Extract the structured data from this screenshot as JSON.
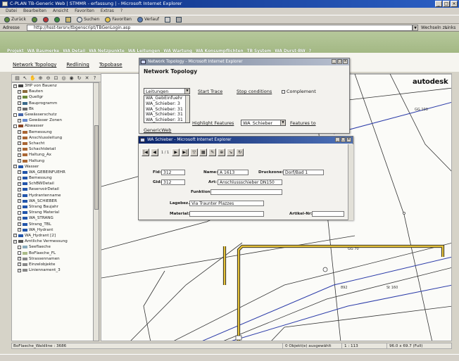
{
  "window": {
    "title": "C-PLAN TB-Generic Web | STMMR - erfassung | - Microsoft Internet Explorer"
  },
  "menu": [
    "Datei",
    "Bearbeiten",
    "Ansicht",
    "Favoriten",
    "Extras",
    "?"
  ],
  "toolbar": {
    "back": "Zurück",
    "search": "Suchen",
    "favorites": "Favoriten",
    "history": "Verlauf"
  },
  "address": {
    "label": "Adresse",
    "url": "http://hsst-tersrv/tbgenscript/TBGenLogin.asp",
    "go": "Wechseln zu",
    "links": "Links"
  },
  "app_nav": [
    "Projekt",
    "WA Baumerke",
    "WA Detail",
    "WA Netzpunkte",
    "WA Leitungen",
    "WA Wartung",
    "WA Konsumpflichten",
    "TB System",
    "WA Durst-BW",
    "?"
  ],
  "top_links": [
    "Network Topology",
    "Redlining",
    "Topobase"
  ],
  "brand": "autodesk",
  "layers": [
    {
      "cb": "x",
      "label": "3HP von Bauenz",
      "lvl": 0,
      "color": "#444"
    },
    {
      "cb": "x",
      "label": "Bauten",
      "lvl": 1,
      "color": "#8a6a3a"
    },
    {
      "cb": "x",
      "label": "Quellgr",
      "lvl": 1,
      "color": "#6a8a3a"
    },
    {
      "cb": "x",
      "label": "Bauprogramm",
      "lvl": 1,
      "color": "#3a6a8a"
    },
    {
      "cb": "x",
      "label": "Bk",
      "lvl": 1,
      "color": "#6a6a6a"
    },
    {
      "cb": "",
      "label": "Gewässerschutz",
      "lvl": 0,
      "color": "#4466aa"
    },
    {
      "cb": "x",
      "label": "Gewässer Zonen",
      "lvl": 1,
      "color": "#6688cc"
    },
    {
      "cb": "",
      "label": "Abwasser",
      "lvl": 0,
      "color": "#884422"
    },
    {
      "cb": "x",
      "label": "Bemessung",
      "lvl": 1,
      "color": "#aa6633"
    },
    {
      "cb": "x",
      "label": "Anschlussleitung",
      "lvl": 1,
      "color": "#aa6633"
    },
    {
      "cb": "x",
      "label": "Schacht",
      "lvl": 1,
      "color": "#aa6633"
    },
    {
      "cb": "x",
      "label": "Schachtdetail",
      "lvl": 1,
      "color": "#aa6633"
    },
    {
      "cb": "x",
      "label": "Haltung_Ax",
      "lvl": 1,
      "color": "#aa6633"
    },
    {
      "cb": "x",
      "label": "Haltung",
      "lvl": 1,
      "color": "#aa6633"
    },
    {
      "cb": "x",
      "label": "Wasser",
      "lvl": 0,
      "color": "#2255aa"
    },
    {
      "cb": "x",
      "label": "WA_GEBEINFUEHR",
      "lvl": 1,
      "color": "#2255aa"
    },
    {
      "cb": "",
      "label": "Bemessung",
      "lvl": 1,
      "color": "#2255aa"
    },
    {
      "cb": "x",
      "label": "SchBWDetail",
      "lvl": 1,
      "color": "#2255aa"
    },
    {
      "cb": "x",
      "label": "ReservoirDetail",
      "lvl": 1,
      "color": "#2255aa"
    },
    {
      "cb": "x",
      "label": "Hydrantenname",
      "lvl": 1,
      "color": "#2255aa"
    },
    {
      "cb": "x",
      "label": "WA_SCHIEBER",
      "lvl": 1,
      "color": "#2255aa"
    },
    {
      "cb": "",
      "label": "Strang Baujahr",
      "lvl": 1,
      "color": "#2255aa"
    },
    {
      "cb": "",
      "label": "Strang Material",
      "lvl": 1,
      "color": "#2255aa"
    },
    {
      "cb": "x",
      "label": "WA_STRANG",
      "lvl": 1,
      "color": "#2255aa"
    },
    {
      "cb": "x",
      "label": "Strang_TBL",
      "lvl": 1,
      "color": "#2255aa"
    },
    {
      "cb": "x",
      "label": "WA_Hydrant",
      "lvl": 1,
      "color": "#2255aa"
    },
    {
      "cb": "x",
      "label": "WA_Hydrant [2]",
      "lvl": 0,
      "color": "#2255aa"
    },
    {
      "cb": "x",
      "label": "Amtliche Vermessung",
      "lvl": 0,
      "color": "#555"
    },
    {
      "cb": "",
      "label": "Seeflaeche",
      "lvl": 1,
      "color": "#8ab"
    },
    {
      "cb": "",
      "label": "BoFlaeche_FL",
      "lvl": 1,
      "color": "#ab8"
    },
    {
      "cb": "x",
      "label": "Strassennamen",
      "lvl": 1,
      "color": "#888"
    },
    {
      "cb": "x",
      "label": "Einzelobjekte",
      "lvl": 1,
      "color": "#888"
    },
    {
      "cb": "x",
      "label": "Liniennament_3",
      "lvl": 1,
      "color": "#888"
    }
  ],
  "status": {
    "left": "BoFlaeche_Waldline : 3686",
    "selected": "0 Objekt(e) ausgewählt",
    "scale": "1 : 113",
    "size": "96.0 x 69.7 (Full)"
  },
  "map_labels": {
    "gg100": "GG 100",
    "gg70": "GG 70",
    "st160": "St 160",
    "n892": "892"
  },
  "network_topology": {
    "title": "Network Topology - Microsoft Internet Explorer",
    "heading": "Network Topology",
    "dropdown": "Leitungen",
    "start_trace": "Start Trace",
    "stop_conditions": "Stop conditions",
    "complement": "Complement",
    "list": [
      "WA_GebEinfuehr",
      "WA_Schieber: 3",
      "WA_Schieber: 31",
      "WA_Schieber: 31",
      "WA_Schieber: 31",
      "WA_Strang: 233"
    ],
    "highlight": "Highlight Features",
    "class_select": "WA_Schieber",
    "features_to": "Features to",
    "generic_web": "GenericWeb"
  },
  "wa_schieber": {
    "title": "WA Schieber - Microsoft Internet Explorer",
    "nav_info": "1 / 1",
    "fid_label": "Fid:",
    "fid": "312",
    "name_label": "Name:",
    "name": "A 1613",
    "druckzone_label": "Druckzone:",
    "druckzone": "Dorf/Bad 1",
    "gid_label": "Gid:",
    "gid": "312",
    "art_label": "Art:",
    "art": "Anschlussschieber DN150",
    "funktion_label": "Funktion:",
    "funktion": "",
    "lagebez_label": "Lagebez.:",
    "lagebez": "Via Traunter Plazzes",
    "material_label": "Material:",
    "material": "",
    "artikel_label": "Artikel-Nr:",
    "artikel": ""
  }
}
